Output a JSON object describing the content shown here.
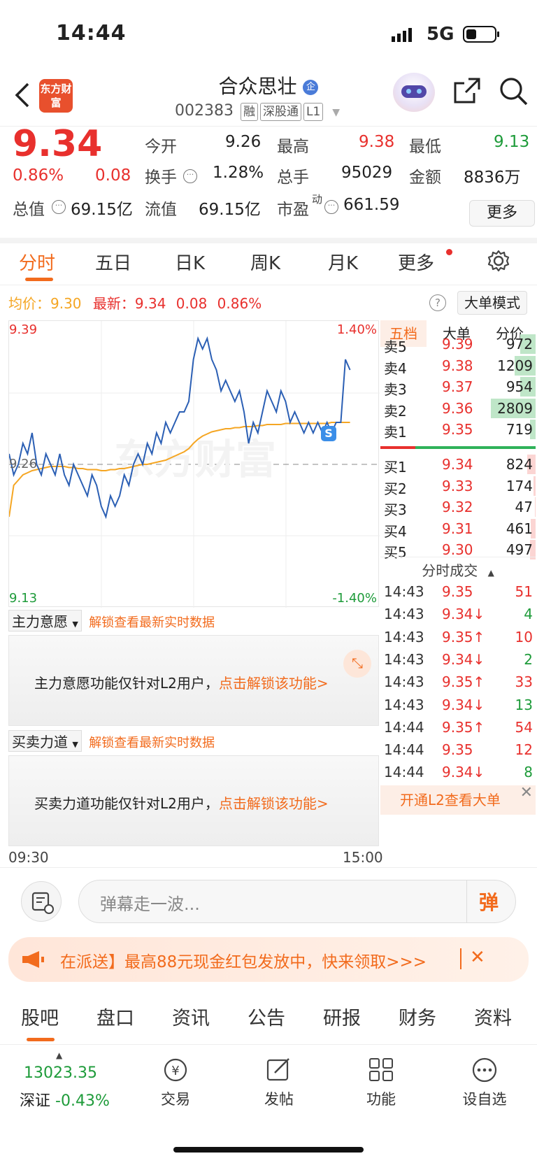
{
  "status": {
    "time": "14:44",
    "network": "5G"
  },
  "header": {
    "logo_text": "东方财富",
    "stock_name": "合众思壮",
    "stock_badge": "企",
    "code": "002383",
    "tags": [
      "融",
      "深股通",
      "L1"
    ]
  },
  "quote": {
    "price": "9.34",
    "change_pct": "0.86%",
    "change": "0.08",
    "open_label": "今开",
    "open": "9.26",
    "high_label": "最高",
    "high": "9.38",
    "low_label": "最低",
    "low": "9.13",
    "turnover_label": "换手",
    "turnover": "1.28%",
    "volume_label": "总手",
    "volume": "95029",
    "amount_label": "金额",
    "amount": "8836万",
    "mktcap_label": "总值",
    "mktcap": "69.15亿",
    "float_label": "流值",
    "float": "69.15亿",
    "pe_label": "市盈",
    "pe_sup": "动",
    "pe": "661.59",
    "more": "更多"
  },
  "tabs": [
    "分时",
    "五日",
    "日K",
    "周K",
    "月K",
    "更多"
  ],
  "avg": {
    "avg_label": "均价：",
    "avg_value": "9.30",
    "latest_label": "最新：",
    "latest_price": "9.34",
    "latest_change": "0.08",
    "latest_pct": "0.86%",
    "bigorder_btn": "大单模式",
    "help": "?"
  },
  "chart_data": {
    "type": "line",
    "y_top": "9.39",
    "y_bottom": "9.13",
    "pct_top": "1.40%",
    "pct_bottom": "-1.40%",
    "mid_label": "9.26",
    "x_start": "09:30",
    "x_end": "15:00",
    "ylim": [
      9.13,
      9.39
    ],
    "prev_close": 9.26,
    "watermark": "东方财富",
    "series": [
      {
        "values": [
          9.27,
          9.25,
          9.26,
          9.28,
          9.27,
          9.29,
          9.26,
          9.25,
          9.27,
          9.26,
          9.25,
          9.27,
          9.25,
          9.24,
          9.26,
          9.25,
          9.24,
          9.23,
          9.25,
          9.24,
          9.22,
          9.21,
          9.23,
          9.22,
          9.23,
          9.25,
          9.24,
          9.26,
          9.27,
          9.26,
          9.28,
          9.27,
          9.29,
          9.28,
          9.3,
          9.29,
          9.3,
          9.31,
          9.31,
          9.32,
          9.36,
          9.38,
          9.37,
          9.38,
          9.36,
          9.35,
          9.33,
          9.34,
          9.33,
          9.32,
          9.33,
          9.31,
          9.28,
          9.3,
          9.29,
          9.31,
          9.33,
          9.32,
          9.31,
          9.33,
          9.32,
          9.3,
          9.31,
          9.3,
          9.29,
          9.3,
          9.29,
          9.3,
          9.29,
          9.3,
          9.29,
          9.3,
          9.3,
          9.36,
          9.35
        ]
      },
      {
        "values": [
          9.21,
          9.24,
          9.245,
          9.25,
          9.252,
          9.254,
          9.255,
          9.256,
          9.257,
          9.258,
          9.258,
          9.258,
          9.258,
          9.257,
          9.257,
          9.256,
          9.256,
          9.255,
          9.255,
          9.255,
          9.254,
          9.254,
          9.255,
          9.255,
          9.256,
          9.256,
          9.257,
          9.258,
          9.259,
          9.26,
          9.26,
          9.261,
          9.262,
          9.263,
          9.264,
          9.266,
          9.268,
          9.27,
          9.272,
          9.275,
          9.28,
          9.284,
          9.287,
          9.289,
          9.291,
          9.292,
          9.293,
          9.294,
          9.294,
          9.295,
          9.295,
          9.296,
          9.296,
          9.296,
          9.297,
          9.297,
          9.298,
          9.298,
          9.298,
          9.298,
          9.299,
          9.299,
          9.299,
          9.299,
          9.299,
          9.299,
          9.299,
          9.299,
          9.299,
          9.299,
          9.3,
          9.3,
          9.3,
          9.3,
          9.3
        ]
      }
    ]
  },
  "depth": {
    "tabs": [
      "五档",
      "大单",
      "分价"
    ],
    "sells": [
      {
        "label": "卖5",
        "price": "9.39",
        "vol": "972",
        "ratio": 0.28
      },
      {
        "label": "卖4",
        "price": "9.38",
        "vol": "1209",
        "ratio": 0.38
      },
      {
        "label": "卖3",
        "price": "9.37",
        "vol": "954",
        "ratio": 0.28
      },
      {
        "label": "卖2",
        "price": "9.36",
        "vol": "2809",
        "ratio": 0.8
      },
      {
        "label": "卖1",
        "price": "9.35",
        "vol": "719",
        "ratio": 0.1
      }
    ],
    "buys": [
      {
        "label": "买1",
        "price": "9.34",
        "vol": "824",
        "ratio": 0.15
      },
      {
        "label": "买2",
        "price": "9.33",
        "vol": "174",
        "ratio": 0.04
      },
      {
        "label": "买3",
        "price": "9.32",
        "vol": "47",
        "ratio": 0.01
      },
      {
        "label": "买4",
        "price": "9.31",
        "vol": "461",
        "ratio": 0.09
      },
      {
        "label": "买5",
        "price": "9.30",
        "vol": "497",
        "ratio": 0.1
      }
    ],
    "trades_title": "分时成交",
    "trades": [
      {
        "time": "14:43",
        "price": "9.35",
        "vol": "51",
        "dir": "",
        "color": "red"
      },
      {
        "time": "14:43",
        "price": "9.34↓",
        "vol": "4",
        "dir": "down",
        "color": "green"
      },
      {
        "time": "14:43",
        "price": "9.35↑",
        "vol": "10",
        "dir": "up",
        "color": "red"
      },
      {
        "time": "14:43",
        "price": "9.34↓",
        "vol": "2",
        "dir": "down",
        "color": "green"
      },
      {
        "time": "14:43",
        "price": "9.35↑",
        "vol": "33",
        "dir": "up",
        "color": "red"
      },
      {
        "time": "14:43",
        "price": "9.34↓",
        "vol": "13",
        "dir": "down",
        "color": "green"
      },
      {
        "time": "14:44",
        "price": "9.35↑",
        "vol": "54",
        "dir": "up",
        "color": "red"
      },
      {
        "time": "14:44",
        "price": "9.35",
        "vol": "12",
        "dir": "",
        "color": "red"
      },
      {
        "time": "14:44",
        "price": "9.34↓",
        "vol": "8",
        "dir": "down",
        "color": "green"
      }
    ],
    "l2_promo": "开通L2查看大单"
  },
  "panels": {
    "main_force": {
      "label": "主力意愿",
      "unlock_hint": "解锁查看最新实时数据",
      "body": "主力意愿功能仅针对L2用户，",
      "link": "点击解锁该功能>"
    },
    "force": {
      "label": "买卖力道",
      "unlock_hint": "解锁查看最新实时数据",
      "body": "买卖力道功能仅针对L2用户，",
      "link": "点击解锁该功能>"
    }
  },
  "danmu": {
    "placeholder": "弹幕走一波...",
    "btn": "弹"
  },
  "banner": {
    "text": "在派送】最高88元现金红包发放中，快来领取>>>"
  },
  "bottom_tabs": [
    "股吧",
    "盘口",
    "资讯",
    "公告",
    "研报",
    "财务",
    "资料"
  ],
  "toolbar": {
    "index_value": "13023.35",
    "index_name": "深证",
    "index_pct": "-0.43%",
    "items": [
      "交易",
      "发帖",
      "功能",
      "设自选"
    ]
  },
  "colors": {
    "accent": "#f26b1d",
    "up": "#e8302d",
    "down": "#1e9b3a",
    "price_line": "#2b5fb4",
    "avg_line": "#f5a623"
  }
}
